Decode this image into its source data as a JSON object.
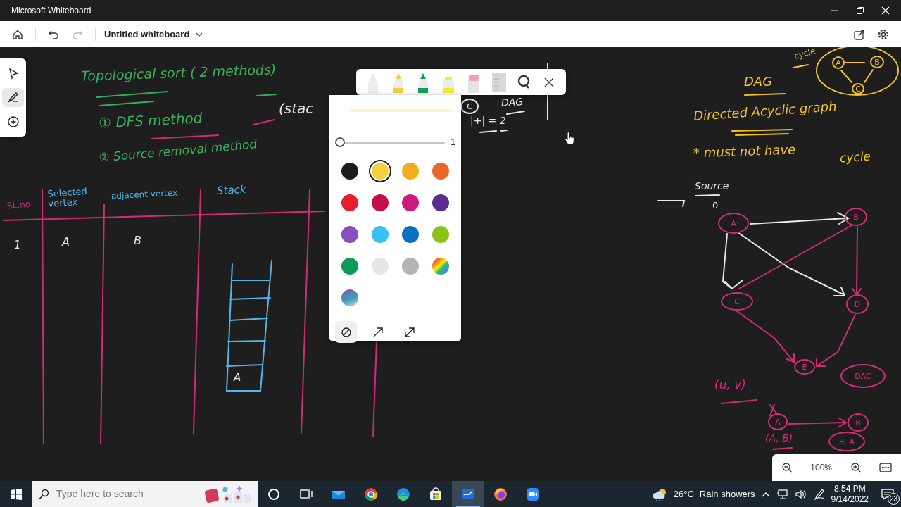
{
  "window": {
    "title": "Microsoft Whiteboard"
  },
  "app_bar": {
    "title": "Untitled whiteboard",
    "buttons": [
      {
        "kind": "home",
        "disabled": false
      },
      {
        "kind": "undo",
        "disabled": false
      },
      {
        "kind": "redo",
        "disabled": true
      }
    ]
  },
  "tool_rail": [
    {
      "kind": "select",
      "selected": false
    },
    {
      "kind": "pen",
      "selected": true
    },
    {
      "kind": "add",
      "selected": false
    }
  ],
  "pen_toolbar": {
    "tools": [
      {
        "kind": "pen",
        "color": "#e8e8e8"
      },
      {
        "kind": "pencil",
        "color": "#f2cf3a"
      },
      {
        "kind": "marker",
        "color": "#12a05a"
      },
      {
        "kind": "highlighter",
        "color": "#f6ea2a"
      },
      {
        "kind": "eraser",
        "color": "#f0a0b4"
      },
      {
        "kind": "ruler",
        "color": "#d8d8d8"
      },
      {
        "kind": "lasso",
        "color": "#333333"
      }
    ]
  },
  "pen_options": {
    "size": {
      "level": 0,
      "reading": "1"
    },
    "colors": [
      {
        "kind": "solid",
        "color": "#1b1b1b",
        "selected": false
      },
      {
        "kind": "solid",
        "color": "#f3d03e",
        "selected": true
      },
      {
        "kind": "solid",
        "color": "#f0ae1e",
        "selected": false
      },
      {
        "kind": "solid",
        "color": "#e8682a",
        "selected": false
      },
      {
        "kind": "solid",
        "color": "#e31e2e",
        "selected": false
      },
      {
        "kind": "solid",
        "color": "#c50f4a",
        "selected": false
      },
      {
        "kind": "solid",
        "color": "#d0197c",
        "selected": false
      },
      {
        "kind": "solid",
        "color": "#5a2d91",
        "selected": false
      },
      {
        "kind": "solid",
        "color": "#8a4fbf",
        "selected": false
      },
      {
        "kind": "solid",
        "color": "#38c2ef",
        "selected": false
      },
      {
        "kind": "solid",
        "color": "#0a6fc2",
        "selected": false
      },
      {
        "kind": "solid",
        "color": "#8cc31a",
        "selected": false
      },
      {
        "kind": "solid",
        "color": "#109a58",
        "selected": false
      },
      {
        "kind": "solid",
        "color": "#e6e6e6",
        "selected": false
      },
      {
        "kind": "solid",
        "color": "#b4b4b4",
        "selected": false
      },
      {
        "kind": "rainbow",
        "selected": false
      },
      {
        "kind": "galaxy",
        "selected": false
      }
    ],
    "line_ends": [
      {
        "kind": "none",
        "selected": true
      },
      {
        "kind": "arrow",
        "selected": false
      },
      {
        "kind": "double",
        "selected": false
      }
    ]
  },
  "ink": [
    {
      "kind": "text",
      "text": "Topological sort ( 2 methods)",
      "color": "#35b05a"
    },
    {
      "kind": "text",
      "text": "① DFS method",
      "color": "#35b05a"
    },
    {
      "kind": "text",
      "text": "(stac",
      "color": "#e8e8e8"
    },
    {
      "kind": "text",
      "text": "② Source removal method",
      "color": "#35b05a"
    },
    {
      "kind": "text",
      "text": "SL.no",
      "color": "#d42a7a"
    },
    {
      "kind": "text",
      "text": "Selected vertex",
      "color": "#4fb8e8"
    },
    {
      "kind": "text",
      "text": "adjacent vertex",
      "color": "#4fb8e8"
    },
    {
      "kind": "text",
      "text": "Stack",
      "color": "#4fb8e8"
    },
    {
      "kind": "text",
      "text": "1",
      "color": "#e8e8e8"
    },
    {
      "kind": "text",
      "text": "A",
      "color": "#e8e8e8"
    },
    {
      "kind": "text",
      "text": "B",
      "color": "#e8e8e8"
    },
    {
      "kind": "text",
      "text": "A",
      "color": "#e8e8e8"
    },
    {
      "kind": "text",
      "text": "DAG",
      "color": "#e8e8e8"
    },
    {
      "kind": "text",
      "text": "|+| = 2",
      "color": "#e8e8e8"
    },
    {
      "kind": "node",
      "text": "C",
      "color": "#e8e8e8"
    },
    {
      "kind": "text",
      "text": "DAG",
      "color": "#f2c230"
    },
    {
      "kind": "text",
      "text": "cycle",
      "color": "#f2c230"
    },
    {
      "kind": "node",
      "text": "A",
      "color": "#f2c230"
    },
    {
      "kind": "node",
      "text": "B",
      "color": "#f2c230"
    },
    {
      "kind": "node",
      "text": "C",
      "color": "#f2c230"
    },
    {
      "kind": "text",
      "text": "Directed Acyclic graph",
      "color": "#f2c230"
    },
    {
      "kind": "text",
      "text": "* must not have",
      "color": "#f2c230"
    },
    {
      "kind": "text",
      "text": "cycle",
      "color": "#f2c230"
    },
    {
      "kind": "text",
      "text": "Source",
      "color": "#e8e8e8"
    },
    {
      "kind": "text",
      "text": "0",
      "color": "#e8e8e8"
    },
    {
      "kind": "node",
      "text": "A",
      "color": "#d42a7a"
    },
    {
      "kind": "node",
      "text": "B",
      "color": "#d42a7a"
    },
    {
      "kind": "node",
      "text": "C",
      "color": "#d42a7a"
    },
    {
      "kind": "node",
      "text": "D",
      "color": "#d42a7a"
    },
    {
      "kind": "node",
      "text": "E",
      "color": "#d42a7a"
    },
    {
      "kind": "node",
      "text": "DAC",
      "color": "#d42a7a"
    },
    {
      "kind": "text",
      "text": "(u, v)",
      "color": "#d42a7a"
    },
    {
      "kind": "node",
      "text": "A",
      "color": "#d42a7a"
    },
    {
      "kind": "node",
      "text": "B",
      "color": "#d42a7a"
    },
    {
      "kind": "text",
      "text": "(A, B)",
      "color": "#d42a7a"
    },
    {
      "kind": "node",
      "text": "B, A",
      "color": "#d42a7a"
    }
  ],
  "zoom": {
    "reading": "100%"
  },
  "taskbar": {
    "search_placeholder": "Type here to search",
    "apps": [
      {
        "kind": "taskview",
        "active": false
      },
      {
        "kind": "mail",
        "active": false
      },
      {
        "kind": "chrome",
        "active": false
      },
      {
        "kind": "edge",
        "active": false
      },
      {
        "kind": "store",
        "active": false
      },
      {
        "kind": "whiteboard",
        "active": true
      },
      {
        "kind": "firefox",
        "active": false
      },
      {
        "kind": "zoom",
        "active": false
      }
    ],
    "weather": {
      "temperature": "26°C",
      "condition": "Rain showers"
    },
    "time": "8:54 PM",
    "date": "9/14/2022",
    "notifications": "23"
  }
}
